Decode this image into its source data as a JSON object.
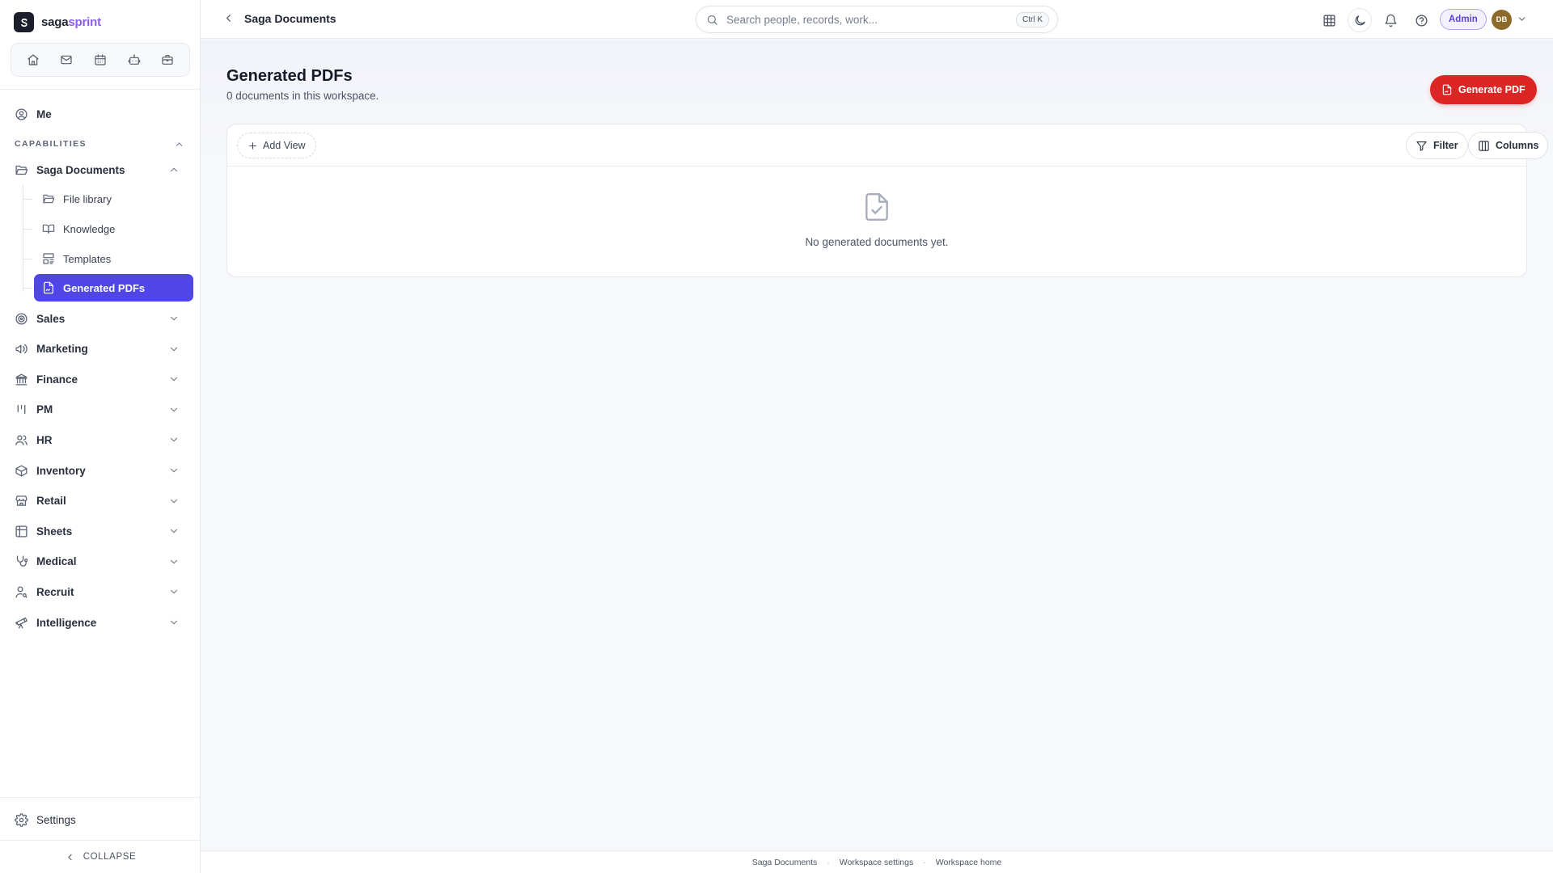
{
  "brand": {
    "name_part1": "saga",
    "name_part2": "sprint",
    "logo_letter": "S"
  },
  "quickbar": {
    "icons": [
      "home-icon",
      "mail-icon",
      "calendar-icon",
      "bot-icon",
      "briefcase-icon"
    ]
  },
  "sidebar": {
    "me_label": "Me",
    "section_label": "CAPABILITIES",
    "group": {
      "label": "Saga Documents",
      "children": [
        {
          "label": "File library",
          "icon": "folder-icon"
        },
        {
          "label": "Knowledge",
          "icon": "book-icon"
        },
        {
          "label": "Templates",
          "icon": "template-icon"
        },
        {
          "label": "Generated PDFs",
          "icon": "file-signature-icon",
          "active": true
        }
      ]
    },
    "items": [
      {
        "label": "Sales",
        "icon": "target-icon"
      },
      {
        "label": "Marketing",
        "icon": "megaphone-icon"
      },
      {
        "label": "Finance",
        "icon": "bank-icon"
      },
      {
        "label": "PM",
        "icon": "kanban-icon"
      },
      {
        "label": "HR",
        "icon": "users-icon"
      },
      {
        "label": "Inventory",
        "icon": "box-icon"
      },
      {
        "label": "Retail",
        "icon": "store-icon"
      },
      {
        "label": "Sheets",
        "icon": "table-icon"
      },
      {
        "label": "Medical",
        "icon": "stethoscope-icon"
      },
      {
        "label": "Recruit",
        "icon": "user-search-icon"
      },
      {
        "label": "Intelligence",
        "icon": "telescope-icon"
      }
    ],
    "settings_label": "Settings",
    "collapse_label": "COLLAPSE"
  },
  "topbar": {
    "breadcrumb": "Saga Documents",
    "search_placeholder": "Search people, records, work...",
    "search_shortcut": "Ctrl K",
    "admin_label": "Admin",
    "avatar_initials": "DB"
  },
  "page": {
    "title": "Generated PDFs",
    "subtitle": "0 documents in this workspace.",
    "primary_button": "Generate PDF",
    "add_view_label": "Add View",
    "filter_label": "Filter",
    "columns_label": "Columns",
    "empty_message": "No generated documents yet."
  },
  "footer": {
    "links": [
      "Saga Documents",
      "Workspace settings",
      "Workspace home"
    ]
  },
  "colors": {
    "accent": "#4f46e5",
    "primary_action": "#dc2626",
    "brand_accent": "#8b5cf6"
  }
}
